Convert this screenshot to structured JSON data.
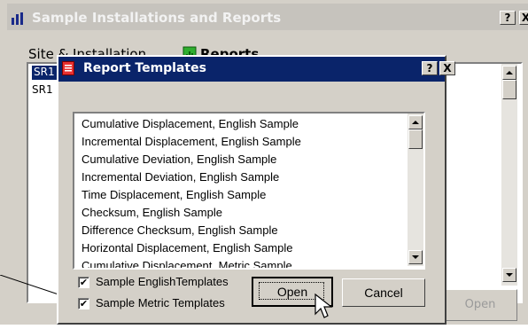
{
  "back_window": {
    "title": "Sample Installations and Reports",
    "help_label": "?",
    "close_label": "X",
    "site_installation_label": "Site & Installation",
    "reports_label": "Reports",
    "list_items": [
      "SR1",
      "SR1"
    ],
    "open_label": "Open"
  },
  "dialog": {
    "title": "Report Templates",
    "help_label": "?",
    "close_label": "X",
    "templates": [
      "Cumulative Displacement, English Sample",
      "Incremental Displacement, English Sample",
      "Cumulative Deviation, English Sample",
      "Incremental Deviation, English Sample",
      "Time Displacement, English Sample",
      "Checksum, English Sample",
      "Difference Checksum, English Sample",
      "Horizontal Displacement, English Sample",
      "Cumulative Displacement, Metric Sample"
    ],
    "checkbox_english": {
      "label": "Sample EnglishTemplates",
      "checked": true,
      "mark": "✔"
    },
    "checkbox_metric": {
      "label": "Sample Metric Templates",
      "checked": true,
      "mark": "✔"
    },
    "open_label": "Open",
    "cancel_label": "Cancel"
  },
  "colors": {
    "active_title": "#0a246a",
    "inactive_title": "#c6c3bd",
    "face": "#d4d0c8",
    "selection": "#0a246a"
  },
  "icons": [
    "bar-chart-icon",
    "reports-icon",
    "report-template-icon",
    "mouse-cursor-icon"
  ]
}
